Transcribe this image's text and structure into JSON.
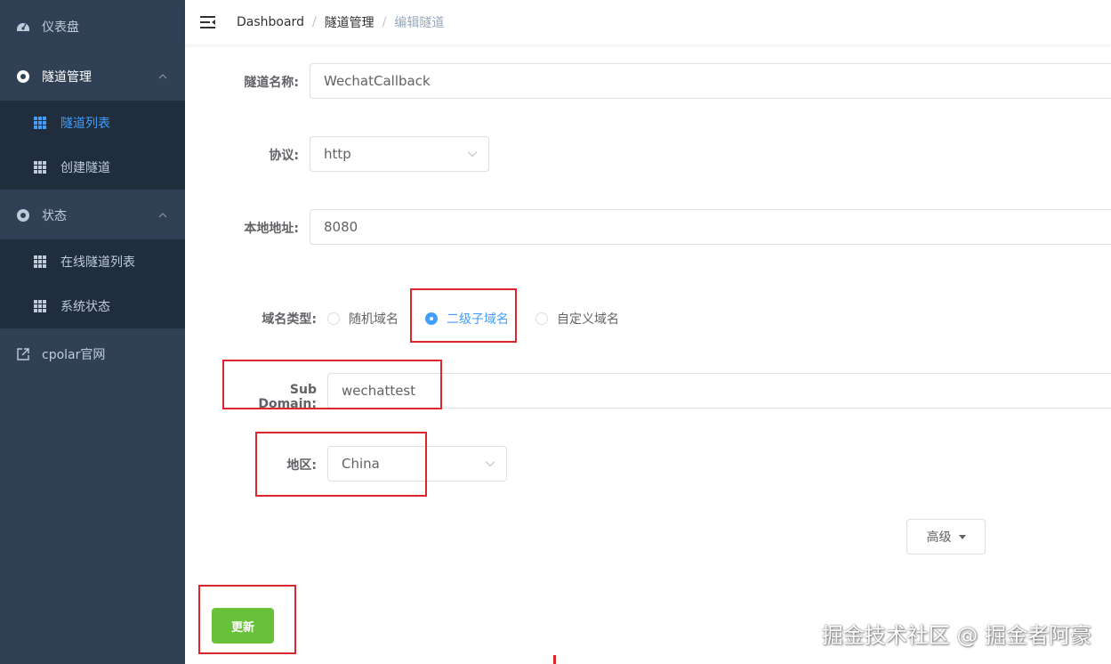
{
  "sidebar": {
    "dashboard": "仪表盘",
    "tunnel_mgmt": "隧道管理",
    "tunnel_list": "隧道列表",
    "create_tunnel": "创建隧道",
    "status": "状态",
    "online_tunnels": "在线隧道列表",
    "system_status": "系统状态",
    "cpolar_site": "cpolar官网"
  },
  "breadcrumb": {
    "home": "Dashboard",
    "section": "隧道管理",
    "current": "编辑隧道",
    "separator": "/"
  },
  "form": {
    "name_label": "隧道名称:",
    "name_value": "WechatCallback",
    "protocol_label": "协议:",
    "protocol_value": "http",
    "local_label": "本地地址:",
    "local_value": "8080",
    "domain_type_label": "域名类型:",
    "domain_options": [
      "随机域名",
      "二级子域名",
      "自定义域名"
    ],
    "domain_selected": "二级子域名",
    "subdomain_label": "Sub Domain:",
    "subdomain_value": "wechattest",
    "region_label": "地区:",
    "region_value": "China",
    "advanced_label": "高级",
    "update_label": "更新"
  },
  "watermark": "掘金技术社区 @ 掘金者阿豪",
  "colors": {
    "sidebar_bg": "#304156",
    "submenu_bg": "#1f2d3d",
    "active": "#409eff",
    "primary_green": "#67c23a",
    "annotation_red": "#d9262f"
  }
}
